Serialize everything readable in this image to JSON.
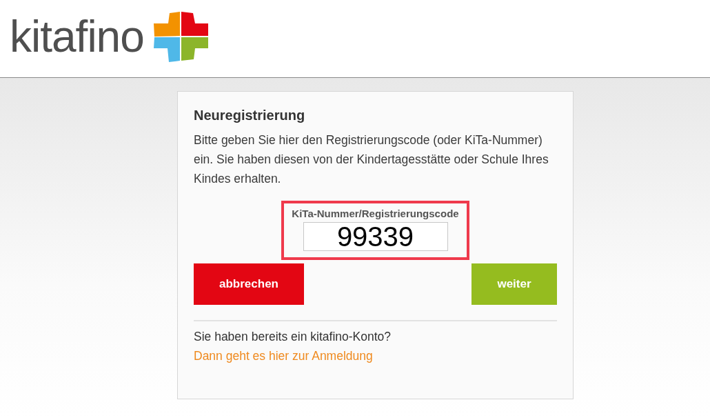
{
  "header": {
    "logo_text": "kitafino"
  },
  "card": {
    "title": "Neuregistrierung",
    "description": "Bitte geben Sie hier den Registrierungscode (oder KiTa-Nummer) ein. Sie haben diesen von der Kindertagesstätte oder Schule Ihres Kindes erhalten.",
    "code_field": {
      "label": "KiTa-Nummer/Registrierungscode",
      "value": "99339",
      "highlighted": true
    },
    "buttons": [
      {
        "label": "abbrechen",
        "kind": "cancel"
      },
      {
        "label": "weiter",
        "kind": "next"
      }
    ],
    "login_prompt": "Sie haben bereits ein kitafino-Konto?",
    "login_link": "Dann geht es hier zur Anmeldung"
  }
}
